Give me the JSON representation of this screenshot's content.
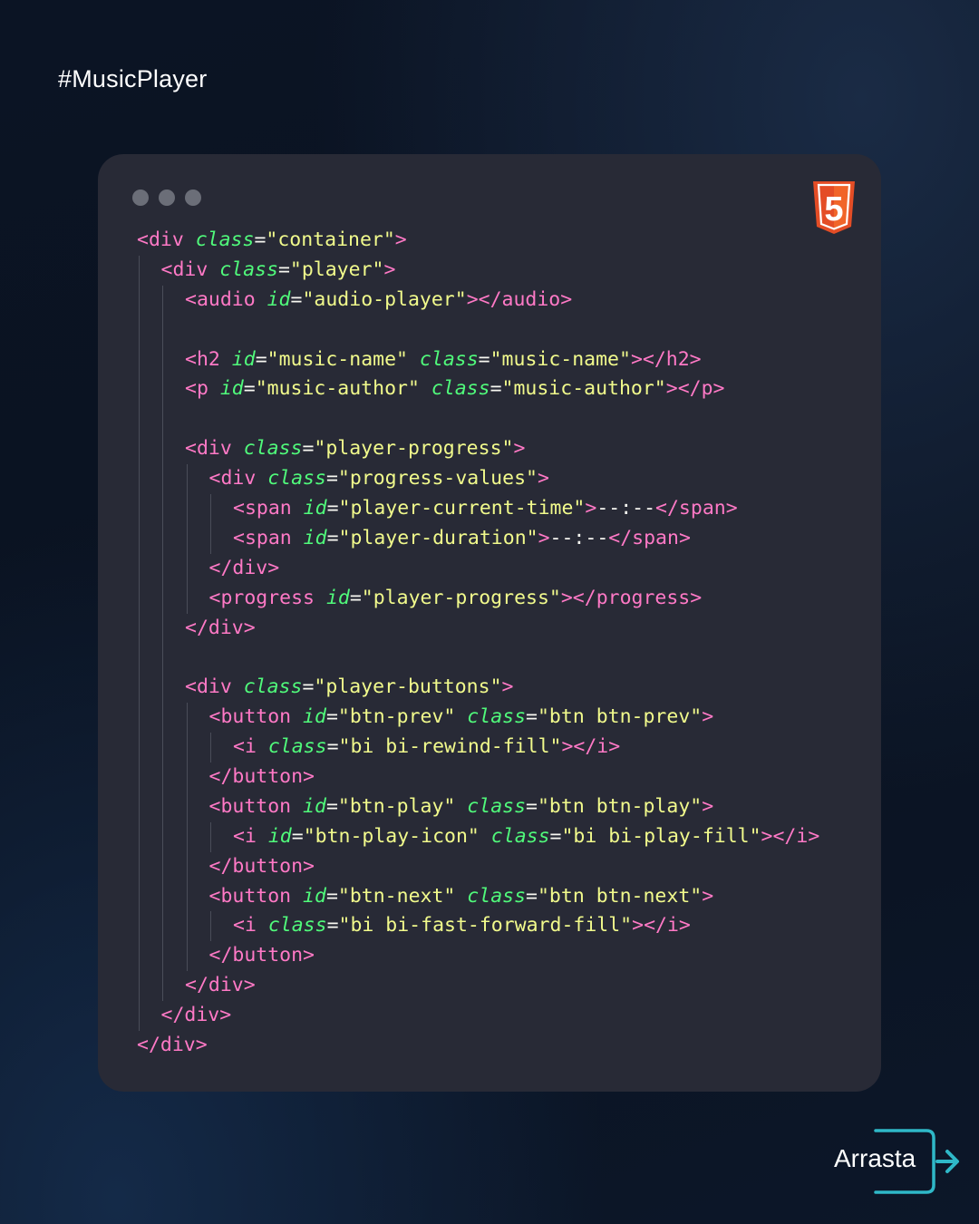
{
  "header": {
    "hashtag": "#MusicPlayer"
  },
  "window": {
    "dots": [
      "window-dot-1",
      "window-dot-2",
      "window-dot-3"
    ],
    "logo_icon": "html5-icon",
    "logo_text": "5"
  },
  "code_lines": [
    {
      "depth": 0,
      "tokens": [
        {
          "t": "tag",
          "v": "<div"
        },
        {
          "t": "attr",
          "v": " class"
        },
        {
          "t": "punct",
          "v": "="
        },
        {
          "t": "str",
          "v": "\"container\""
        },
        {
          "t": "tag",
          "v": ">"
        }
      ]
    },
    {
      "depth": 1,
      "tokens": [
        {
          "t": "tag",
          "v": "<div"
        },
        {
          "t": "attr",
          "v": " class"
        },
        {
          "t": "punct",
          "v": "="
        },
        {
          "t": "str",
          "v": "\"player\""
        },
        {
          "t": "tag",
          "v": ">"
        }
      ]
    },
    {
      "depth": 2,
      "tokens": [
        {
          "t": "tag",
          "v": "<audio"
        },
        {
          "t": "attr",
          "v": " id"
        },
        {
          "t": "punct",
          "v": "="
        },
        {
          "t": "str",
          "v": "\"audio-player\""
        },
        {
          "t": "tag",
          "v": "></audio>"
        }
      ]
    },
    {
      "depth": 2,
      "tokens": []
    },
    {
      "depth": 2,
      "tokens": [
        {
          "t": "tag",
          "v": "<h2"
        },
        {
          "t": "attr",
          "v": " id"
        },
        {
          "t": "punct",
          "v": "="
        },
        {
          "t": "str",
          "v": "\"music-name\""
        },
        {
          "t": "attr",
          "v": " class"
        },
        {
          "t": "punct",
          "v": "="
        },
        {
          "t": "str",
          "v": "\"music-name\""
        },
        {
          "t": "tag",
          "v": "></h2>"
        }
      ]
    },
    {
      "depth": 2,
      "tokens": [
        {
          "t": "tag",
          "v": "<p"
        },
        {
          "t": "attr",
          "v": " id"
        },
        {
          "t": "punct",
          "v": "="
        },
        {
          "t": "str",
          "v": "\"music-author\""
        },
        {
          "t": "attr",
          "v": " class"
        },
        {
          "t": "punct",
          "v": "="
        },
        {
          "t": "str",
          "v": "\"music-author\""
        },
        {
          "t": "tag",
          "v": "></p>"
        }
      ]
    },
    {
      "depth": 2,
      "tokens": []
    },
    {
      "depth": 2,
      "tokens": [
        {
          "t": "tag",
          "v": "<div"
        },
        {
          "t": "attr",
          "v": " class"
        },
        {
          "t": "punct",
          "v": "="
        },
        {
          "t": "str",
          "v": "\"player-progress\""
        },
        {
          "t": "tag",
          "v": ">"
        }
      ]
    },
    {
      "depth": 3,
      "tokens": [
        {
          "t": "tag",
          "v": "<div"
        },
        {
          "t": "attr",
          "v": " class"
        },
        {
          "t": "punct",
          "v": "="
        },
        {
          "t": "str",
          "v": "\"progress-values\""
        },
        {
          "t": "tag",
          "v": ">"
        }
      ]
    },
    {
      "depth": 4,
      "tokens": [
        {
          "t": "tag",
          "v": "<span"
        },
        {
          "t": "attr",
          "v": " id"
        },
        {
          "t": "punct",
          "v": "="
        },
        {
          "t": "str",
          "v": "\"player-current-time\""
        },
        {
          "t": "tag",
          "v": ">"
        },
        {
          "t": "text",
          "v": "--:--"
        },
        {
          "t": "tag",
          "v": "</span>"
        }
      ]
    },
    {
      "depth": 4,
      "tokens": [
        {
          "t": "tag",
          "v": "<span"
        },
        {
          "t": "attr",
          "v": " id"
        },
        {
          "t": "punct",
          "v": "="
        },
        {
          "t": "str",
          "v": "\"player-duration\""
        },
        {
          "t": "tag",
          "v": ">"
        },
        {
          "t": "text",
          "v": "--:--"
        },
        {
          "t": "tag",
          "v": "</span>"
        }
      ]
    },
    {
      "depth": 3,
      "tokens": [
        {
          "t": "tag",
          "v": "</div>"
        }
      ]
    },
    {
      "depth": 3,
      "tokens": [
        {
          "t": "tag",
          "v": "<progress"
        },
        {
          "t": "attr",
          "v": " id"
        },
        {
          "t": "punct",
          "v": "="
        },
        {
          "t": "str",
          "v": "\"player-progress\""
        },
        {
          "t": "tag",
          "v": "></progress>"
        }
      ]
    },
    {
      "depth": 2,
      "tokens": [
        {
          "t": "tag",
          "v": "</div>"
        }
      ]
    },
    {
      "depth": 2,
      "tokens": []
    },
    {
      "depth": 2,
      "tokens": [
        {
          "t": "tag",
          "v": "<div"
        },
        {
          "t": "attr",
          "v": " class"
        },
        {
          "t": "punct",
          "v": "="
        },
        {
          "t": "str",
          "v": "\"player-buttons\""
        },
        {
          "t": "tag",
          "v": ">"
        }
      ]
    },
    {
      "depth": 3,
      "tokens": [
        {
          "t": "tag",
          "v": "<button"
        },
        {
          "t": "attr",
          "v": " id"
        },
        {
          "t": "punct",
          "v": "="
        },
        {
          "t": "str",
          "v": "\"btn-prev\""
        },
        {
          "t": "attr",
          "v": " class"
        },
        {
          "t": "punct",
          "v": "="
        },
        {
          "t": "str",
          "v": "\"btn btn-prev\""
        },
        {
          "t": "tag",
          "v": ">"
        }
      ]
    },
    {
      "depth": 4,
      "tokens": [
        {
          "t": "tag",
          "v": "<i"
        },
        {
          "t": "attr",
          "v": " class"
        },
        {
          "t": "punct",
          "v": "="
        },
        {
          "t": "str",
          "v": "\"bi bi-rewind-fill\""
        },
        {
          "t": "tag",
          "v": "></i>"
        }
      ]
    },
    {
      "depth": 3,
      "tokens": [
        {
          "t": "tag",
          "v": "</button>"
        }
      ]
    },
    {
      "depth": 3,
      "tokens": [
        {
          "t": "tag",
          "v": "<button"
        },
        {
          "t": "attr",
          "v": " id"
        },
        {
          "t": "punct",
          "v": "="
        },
        {
          "t": "str",
          "v": "\"btn-play\""
        },
        {
          "t": "attr",
          "v": " class"
        },
        {
          "t": "punct",
          "v": "="
        },
        {
          "t": "str",
          "v": "\"btn btn-play\""
        },
        {
          "t": "tag",
          "v": ">"
        }
      ]
    },
    {
      "depth": 4,
      "tokens": [
        {
          "t": "tag",
          "v": "<i"
        },
        {
          "t": "attr",
          "v": " id"
        },
        {
          "t": "punct",
          "v": "="
        },
        {
          "t": "str",
          "v": "\"btn-play-icon\""
        },
        {
          "t": "attr",
          "v": " class"
        },
        {
          "t": "punct",
          "v": "="
        },
        {
          "t": "str",
          "v": "\"bi bi-play-fill\""
        },
        {
          "t": "tag",
          "v": "></i>"
        }
      ]
    },
    {
      "depth": 3,
      "tokens": [
        {
          "t": "tag",
          "v": "</button>"
        }
      ]
    },
    {
      "depth": 3,
      "tokens": [
        {
          "t": "tag",
          "v": "<button"
        },
        {
          "t": "attr",
          "v": " id"
        },
        {
          "t": "punct",
          "v": "="
        },
        {
          "t": "str",
          "v": "\"btn-next\""
        },
        {
          "t": "attr",
          "v": " class"
        },
        {
          "t": "punct",
          "v": "="
        },
        {
          "t": "str",
          "v": "\"btn btn-next\""
        },
        {
          "t": "tag",
          "v": ">"
        }
      ]
    },
    {
      "depth": 4,
      "tokens": [
        {
          "t": "tag",
          "v": "<i"
        },
        {
          "t": "attr",
          "v": " class"
        },
        {
          "t": "punct",
          "v": "="
        },
        {
          "t": "str",
          "v": "\"bi bi-fast-forward-fill\""
        },
        {
          "t": "tag",
          "v": "></i>"
        }
      ]
    },
    {
      "depth": 3,
      "tokens": [
        {
          "t": "tag",
          "v": "</button>"
        }
      ]
    },
    {
      "depth": 2,
      "tokens": [
        {
          "t": "tag",
          "v": "</div>"
        }
      ]
    },
    {
      "depth": 1,
      "tokens": [
        {
          "t": "tag",
          "v": "</div>"
        }
      ]
    },
    {
      "depth": 0,
      "tokens": [
        {
          "t": "tag",
          "v": "</div>"
        }
      ]
    }
  ],
  "footer": {
    "swipe_label": "Arrasta",
    "arrow_icon": "arrow-right-icon"
  },
  "colors": {
    "tag": "#ff79c6",
    "attr": "#50fa7b",
    "string": "#f1fa8c",
    "text": "#f8f8f2",
    "card_bg": "#282a36",
    "accent": "#2fb8c8",
    "html5_orange": "#e44d26"
  }
}
